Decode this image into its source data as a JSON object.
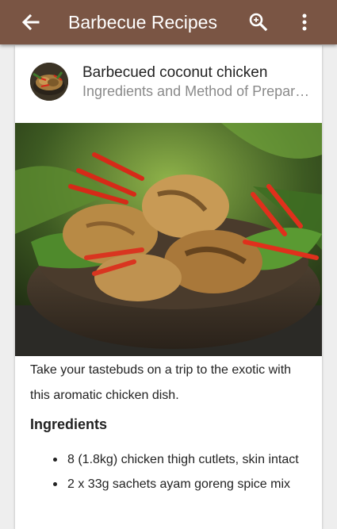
{
  "appbar": {
    "title": "Barbecue Recipes",
    "back_icon": "arrow-back-icon",
    "search_icon": "zoom-in-icon",
    "menu_icon": "more-vert-icon",
    "color": "#7a5544"
  },
  "recipe": {
    "name": "Barbecued coconut chicken",
    "subtitle": "Ingredients and Method of Preparation",
    "intro": "Take your tastebuds on a trip to the exotic with this aromatic chicken dish.",
    "ingredients_heading": "Ingredients",
    "ingredients": [
      "8 (1.8kg) chicken thigh cutlets, skin intact",
      "2 x 33g sachets ayam goreng spice mix"
    ]
  }
}
